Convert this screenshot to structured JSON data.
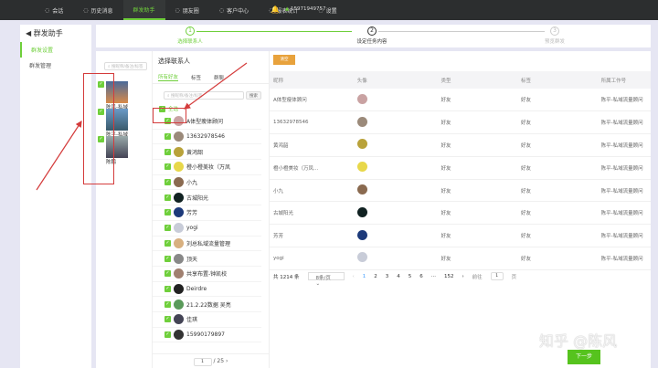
{
  "nav": {
    "items": [
      "会话",
      "历史消息",
      "群发助手",
      "朋友圈",
      "客户中心",
      "报表统计",
      "设置"
    ],
    "active": 2,
    "phone": "15971949757"
  },
  "sidebar": {
    "title": "群发助手",
    "items": [
      "群发设置",
      "群发管理"
    ]
  },
  "steps": [
    {
      "num": "1",
      "label": "选择联系人"
    },
    {
      "num": "2",
      "label": "设定任务内容"
    },
    {
      "num": "3",
      "label": "预览群发"
    }
  ],
  "accounts": {
    "search_placeholder": "搜昵称/备注/标签",
    "items": [
      "陈风-私域",
      "陈平-私域",
      "陈鹏"
    ]
  },
  "contacts": {
    "title": "选择联系人",
    "tabs": [
      "所有好友",
      "标签",
      "群聊"
    ],
    "search_placeholder": "搜昵称/备注/标签",
    "search_button": "搜索",
    "select_all": "全选",
    "items": [
      "A体型瘦体顾问",
      "13632978546",
      "黄鸿韶",
      "橙小橙美妆（万凤",
      "小九",
      "古城阳光",
      "芳芳",
      "yogi",
      "刘总私域流量管理",
      "顶天",
      "共享布置-钟凯校",
      "Deirdre",
      "21.2.22数据 吴亮",
      "佳琪",
      "15990179897"
    ],
    "page": "1",
    "total_pages": "/ 25"
  },
  "table": {
    "clear_button": "清空",
    "headers": [
      "昵称",
      "头像",
      "类型",
      "标签",
      "所属工作号"
    ],
    "rows": [
      [
        "A体型瘦体顾问",
        "好友",
        "好友",
        "陈平-私域流量顾问"
      ],
      [
        "13632978546",
        "好友",
        "好友",
        "陈平-私域流量顾问"
      ],
      [
        "黄鸿韶",
        "好友",
        "好友",
        "陈平-私域流量顾问"
      ],
      [
        "橙小橙美妆（万凤...",
        "好友",
        "好友",
        "陈平-私域流量顾问"
      ],
      [
        "小九",
        "好友",
        "好友",
        "陈平-私域流量顾问"
      ],
      [
        "古城阳光",
        "好友",
        "好友",
        "陈平-私域流量顾问"
      ],
      [
        "芳芳",
        "好友",
        "好友",
        "陈平-私域流量顾问"
      ],
      [
        "yogi",
        "好友",
        "好友",
        "陈平-私域流量顾问"
      ]
    ],
    "avatar_colors": [
      "#c9a2a2",
      "#9b8a7a",
      "#b9a23a",
      "#e8d84a",
      "#8a6a50",
      "#112222",
      "#1d3a7a",
      "#c8ccd8"
    ]
  },
  "pagination": {
    "total": "共 1214 条",
    "page_size": "8条/页",
    "pages": [
      "1",
      "2",
      "3",
      "4",
      "5",
      "6",
      "···",
      "152"
    ],
    "goto_label": "前往",
    "goto_value": "1",
    "goto_suffix": "页"
  },
  "next_button": "下一步",
  "watermark": "知乎 @陈风",
  "colors": {
    "accent": "#6fcf3b",
    "clear": "#e8a23c",
    "annotation": "#d43b3b"
  }
}
